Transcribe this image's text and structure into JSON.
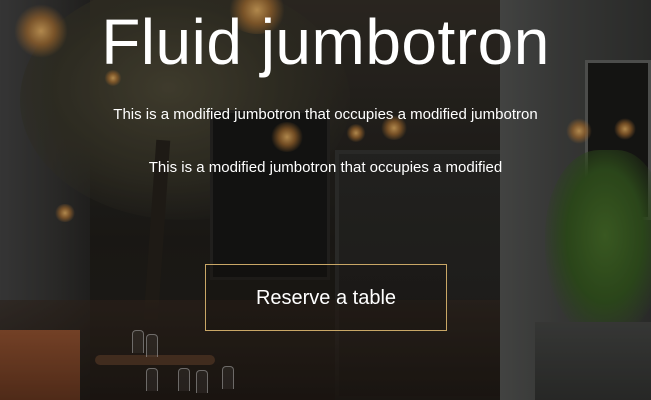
{
  "hero": {
    "title": "Fluid jumbotron",
    "lead_1": "This is a modified jumbotron that occupies a modified jumbotron",
    "lead_2": "This is a modified jumbotron that occupies a modified",
    "cta_label": "Reserve a table"
  },
  "colors": {
    "text": "#ffffff",
    "cta_border": "#c9a766"
  }
}
